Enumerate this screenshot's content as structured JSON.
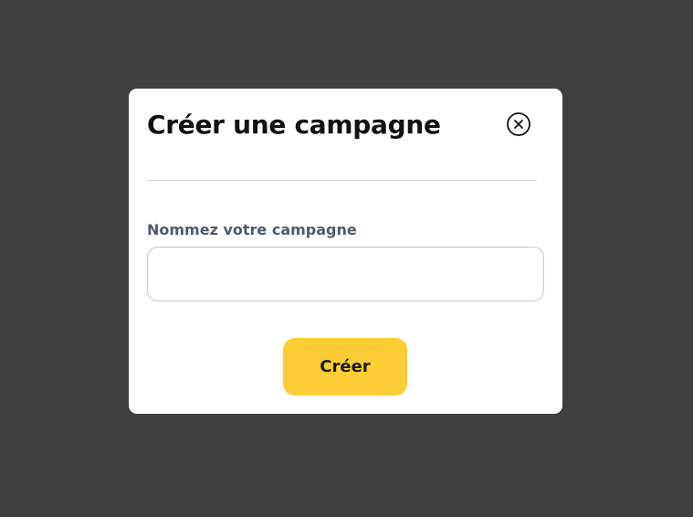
{
  "overlay": {
    "color": "#3f3f3f"
  },
  "modal": {
    "title": "Créer une campagne",
    "close_icon": "close-circle-icon",
    "field": {
      "label": "Nommez votre campagne",
      "value": "",
      "placeholder": ""
    },
    "submit_label": "Créer",
    "accent_color": "#fecd35"
  }
}
